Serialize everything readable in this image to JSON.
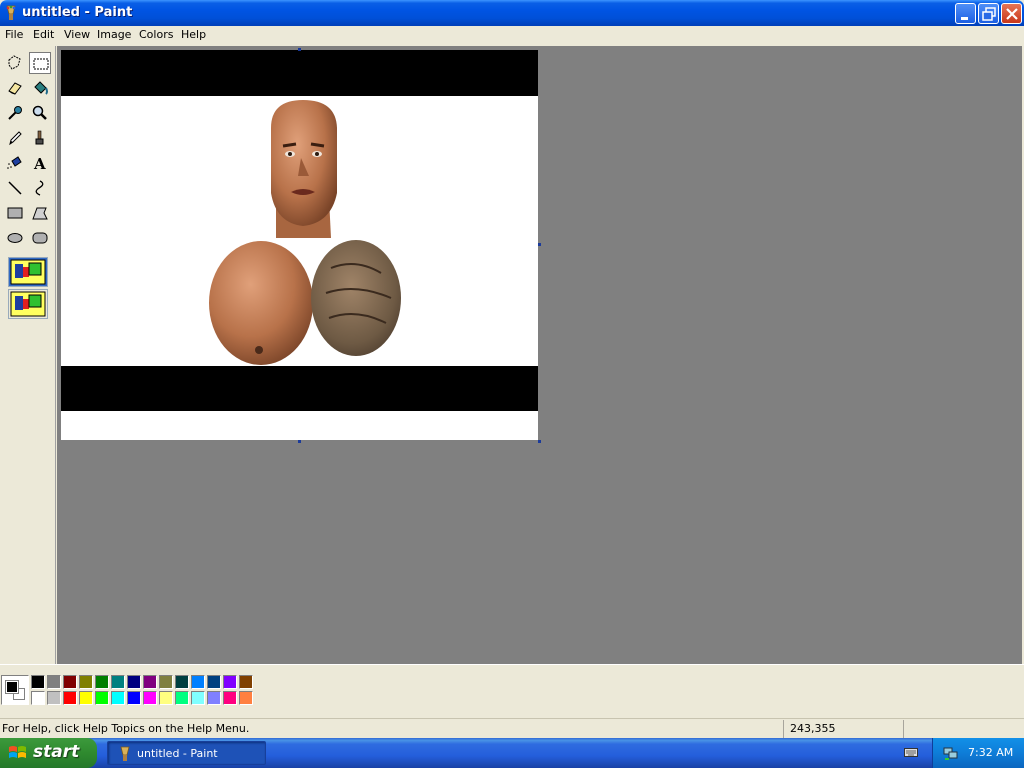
{
  "window": {
    "title": "untitled - Paint"
  },
  "menu": {
    "items": [
      "File",
      "Edit",
      "View",
      "Image",
      "Colors",
      "Help"
    ]
  },
  "toolbox": {
    "tools": [
      "free-form-select-icon",
      "rect-select-icon",
      "eraser-icon",
      "fill-bucket-icon",
      "color-picker-icon",
      "magnifier-icon",
      "pencil-icon",
      "brush-icon",
      "airbrush-icon",
      "text-icon",
      "line-icon",
      "curve-icon",
      "rectangle-icon",
      "polygon-icon",
      "ellipse-icon",
      "rounded-rect-icon"
    ],
    "selected": "rect-select-icon"
  },
  "palette": {
    "row1": [
      "#000000",
      "#808080",
      "#800000",
      "#808000",
      "#008000",
      "#008080",
      "#000080",
      "#800080",
      "#808040",
      "#004040",
      "#0080ff",
      "#004080",
      "#8000ff",
      "#804000"
    ],
    "row2": [
      "#ffffff",
      "#c0c0c0",
      "#ff0000",
      "#ffff00",
      "#00ff00",
      "#00ffff",
      "#0000ff",
      "#ff00ff",
      "#ffff80",
      "#00ff80",
      "#80ffff",
      "#8080ff",
      "#ff0080",
      "#ff8040"
    ],
    "foreground": "#000000",
    "background": "#ffffff"
  },
  "status": {
    "help_text": "For Help, click Help Topics on the Help Menu.",
    "coords": "243,355",
    "size": ""
  },
  "taskbar": {
    "start_label": "start",
    "task_label": "untitled - Paint",
    "clock": "7:32 AM"
  }
}
